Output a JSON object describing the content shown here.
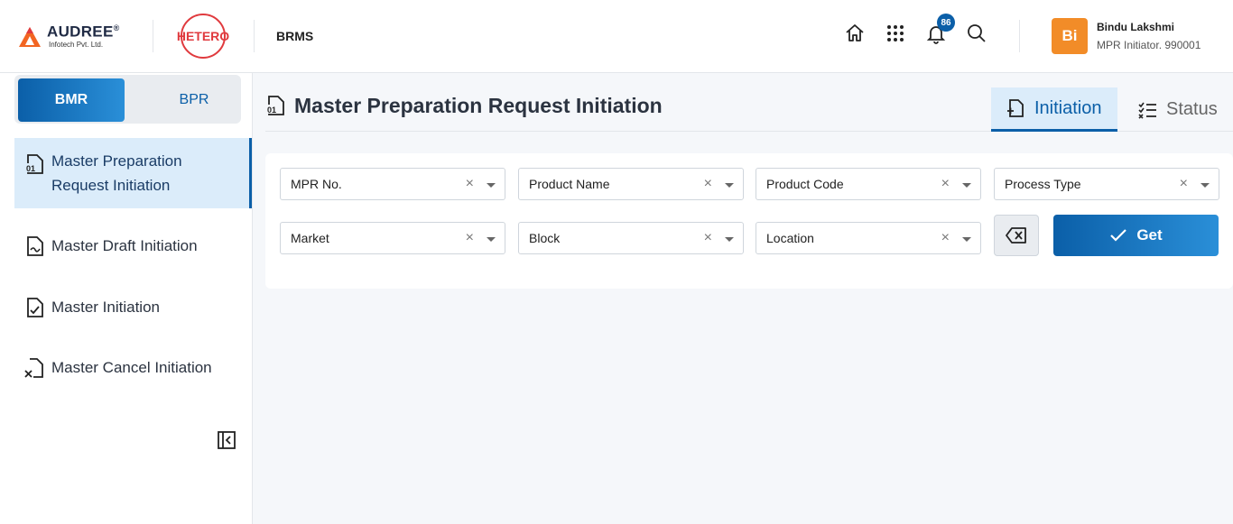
{
  "header": {
    "company_name": "AUDREE",
    "company_reg": "®",
    "company_sub": "Infotech Pvt. Ltd.",
    "partner_logo_text": "HETERO",
    "app_name": "BRMS",
    "notification_count": "86",
    "user": {
      "initials": "Bi",
      "name": "Bindu Lakshmi",
      "role": "MPR Initiator. 990001"
    }
  },
  "sidebar": {
    "toggle": {
      "active": "BMR",
      "inactive": "BPR"
    },
    "items": [
      {
        "label_line1": "Master Preparation",
        "label_line2": "Request Initiation",
        "icon": "document-01-icon"
      },
      {
        "label": "Master Draft Initiation",
        "icon": "draft-doc-icon"
      },
      {
        "label": "Master Initiation",
        "icon": "doc-check-icon"
      },
      {
        "label": "Master Cancel Initiation",
        "icon": "doc-cancel-icon"
      }
    ]
  },
  "main": {
    "title": "Master Preparation Request Initiation",
    "tabs": [
      {
        "label": "Initiation",
        "icon": "add-doc-icon",
        "active": true
      },
      {
        "label": "Status",
        "icon": "checklist-icon",
        "active": false
      }
    ],
    "filters": {
      "mpr_no": "MPR No.",
      "product_name": "Product Name",
      "product_code": "Product Code",
      "process_type": "Process Type",
      "market": "Market",
      "block": "Block",
      "location": "Location"
    },
    "clear_symbol": "×",
    "get_label": "Get"
  },
  "colors": {
    "accent": "#0b5fa8",
    "avatar": "#f28c28",
    "brand_red": "#e03a3e"
  }
}
